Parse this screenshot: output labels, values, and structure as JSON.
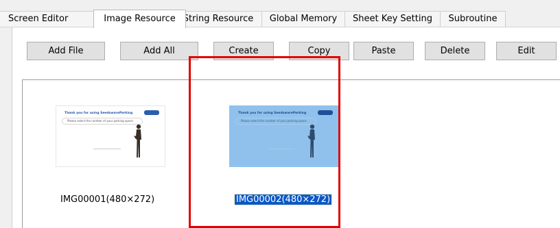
{
  "tabs": [
    {
      "label": "Screen Editor"
    },
    {
      "label": "Image Resource"
    },
    {
      "label": "String Resource"
    },
    {
      "label": "Global Memory"
    },
    {
      "label": "Sheet Key Setting"
    },
    {
      "label": "Subroutine"
    }
  ],
  "active_tab": "Image Resource",
  "toolbar": {
    "add_file": "Add File",
    "add_all": "Add All",
    "create": "Create",
    "copy": "Copy",
    "paste": "Paste",
    "delete": "Delete",
    "edit": "Edit"
  },
  "images": [
    {
      "caption": "IMG00001(480×272)",
      "preview_title": "Thank you for using SeedswareParking",
      "preview_text": "Please select the number of your parking space."
    },
    {
      "caption": "IMG00002(480×272)",
      "preview_title": "Thank you for using SeedswareParking",
      "preview_text": "Please select the number of your parking space.",
      "selected": true
    }
  ],
  "colors": {
    "selection_border": "#e00000",
    "selected_caption_bg": "#0a58c8",
    "selected_thumb_bg": "#8fc1ec"
  }
}
